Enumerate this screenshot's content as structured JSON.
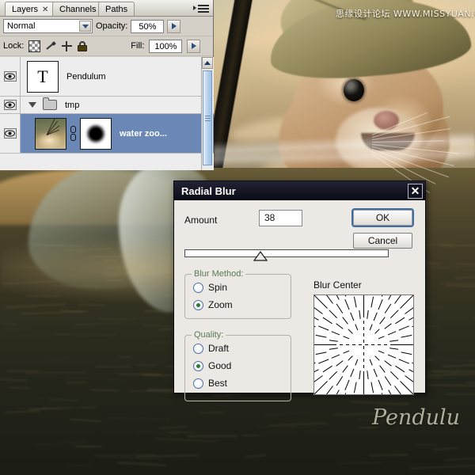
{
  "artwork": {
    "watermark": "思缘设计论坛 WWW.MISSYUAN.COM",
    "signature": "Pendulu"
  },
  "layers_panel": {
    "tabs": [
      {
        "label": "Layers",
        "active": true,
        "closable": true
      },
      {
        "label": "Channels",
        "active": false,
        "closable": false
      },
      {
        "label": "Paths",
        "active": false,
        "closable": false
      }
    ],
    "blend_mode": "Normal",
    "opacity_label": "Opacity:",
    "opacity_value": "50%",
    "lock_label": "Lock:",
    "lock_icons": [
      "lock-transparent-pixels-icon",
      "lock-image-pixels-icon",
      "lock-position-icon",
      "lock-all-icon"
    ],
    "fill_label": "Fill:",
    "fill_value": "100%",
    "layers": [
      {
        "name": "Pendulum",
        "type": "text",
        "visible": true,
        "selected": false,
        "thumb_glyph": "T"
      },
      {
        "name": "tmp",
        "type": "group",
        "visible": true,
        "selected": false,
        "expanded": true
      },
      {
        "name": "water zoo...",
        "type": "image-with-mask",
        "visible": true,
        "selected": true,
        "linked": true
      }
    ]
  },
  "dialog": {
    "title": "Radial Blur",
    "close_label": "✕",
    "amount_label": "Amount",
    "amount_value": "38",
    "amount_min": 1,
    "amount_max": 100,
    "ok_label": "OK",
    "cancel_label": "Cancel",
    "blur_method": {
      "legend": "Blur Method:",
      "options": [
        {
          "label": "Spin",
          "selected": false
        },
        {
          "label": "Zoom",
          "selected": true
        }
      ]
    },
    "quality": {
      "legend": "Quality:",
      "options": [
        {
          "label": "Draft",
          "selected": false
        },
        {
          "label": "Good",
          "selected": true
        },
        {
          "label": "Best",
          "selected": false
        }
      ]
    },
    "blur_center": {
      "label": "Blur Center",
      "pattern": "zoom-radial-lines",
      "center_x": 0.5,
      "center_y": 0.5
    }
  },
  "colors": {
    "selection_blue": "#6a87b5",
    "panel_gray": "#d4d0c8",
    "dialog_gray": "#ece9e4",
    "titlebar_dark": "#111120",
    "radio_green": "#2f7a36",
    "default_button_outline": "#3a6ea5"
  }
}
